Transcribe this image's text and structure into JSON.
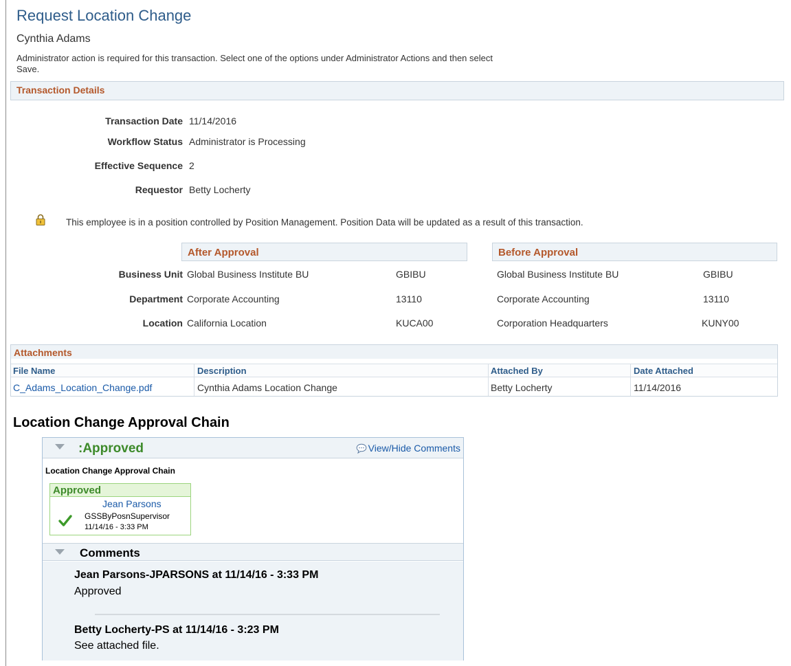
{
  "header": {
    "title": "Request Location Change",
    "employee_name": "Cynthia Adams",
    "instruction": "Administrator action is required for this transaction. Select one of the options under Administrator Actions and then select Save."
  },
  "transaction_details": {
    "title": "Transaction Details",
    "fields": [
      {
        "label": "Transaction Date",
        "value": "11/14/2016"
      },
      {
        "label": "Workflow Status",
        "value": "Administrator is Processing"
      },
      {
        "label": "Effective Sequence",
        "value": "2"
      },
      {
        "label": "Requestor",
        "value": "Betty Locherty"
      }
    ],
    "position_notice": "This employee is in a position controlled by Position Management. Position Data will be updated as a result of this transaction.",
    "lock_icon": "lock-icon"
  },
  "approval_compare": {
    "after_title": "After Approval",
    "before_title": "Before Approval",
    "rows": [
      {
        "label": "Business Unit",
        "after_desc": "Global Business Institute BU",
        "after_code": "GBIBU",
        "before_desc": "Global Business Institute BU",
        "before_code": "GBIBU"
      },
      {
        "label": "Department",
        "after_desc": "Corporate Accounting",
        "after_code": "13110",
        "before_desc": "Corporate Accounting",
        "before_code": "13110"
      },
      {
        "label": "Location",
        "after_desc": "California Location",
        "after_code": "KUCA00",
        "before_desc": "Corporation Headquarters",
        "before_code": "KUNY00"
      }
    ]
  },
  "attachments": {
    "title": "Attachments",
    "columns": [
      "File Name",
      "Description",
      "Attached By",
      "Date Attached"
    ],
    "rows": [
      {
        "file_name": "C_Adams_Location_Change.pdf",
        "description": "Cynthia Adams Location Change",
        "attached_by": "Betty Locherty",
        "date_attached": "11/14/2016"
      }
    ]
  },
  "approval_chain": {
    "heading": "Location Change Approval Chain",
    "status_label": ":Approved",
    "view_hide_label": "View/Hide Comments",
    "chain_title": "Location Change Approval Chain",
    "step": {
      "status": "Approved",
      "approver": "Jean Parsons",
      "role": "GSSByPosnSupervisor",
      "datetime": "11/14/16 - 3:33 PM"
    },
    "comments_title": "Comments",
    "comments": [
      {
        "author": "Jean Parsons-JPARSONS at 11/14/16 - 3:33 PM",
        "text": "Approved"
      },
      {
        "author": "Betty Locherty-PS at 11/14/16 - 3:23 PM",
        "text": "See attached file."
      }
    ]
  },
  "colors": {
    "title_blue": "#2e5c8a",
    "section_orange": "#b4582b",
    "approved_green": "#3d8a2a",
    "link_blue": "#1a5aa8"
  }
}
